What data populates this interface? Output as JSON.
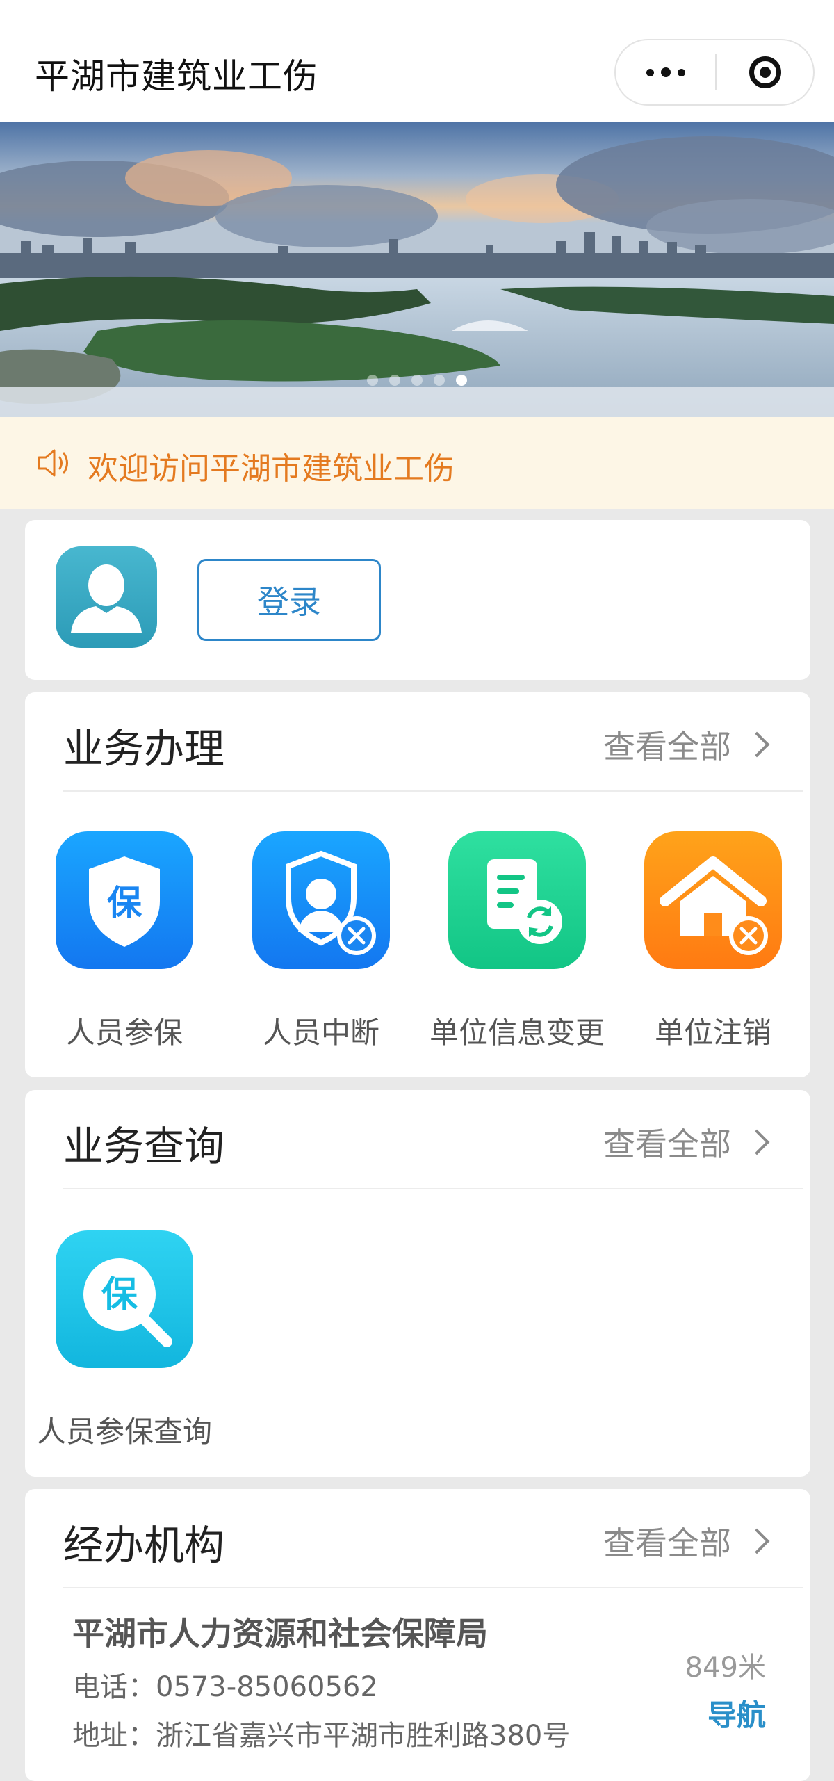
{
  "navbar": {
    "title": "平湖市建筑业工伤",
    "more_icon": "more-dots-icon",
    "close_icon": "target-close-icon"
  },
  "banner": {
    "slide_count": 5,
    "active_index": 4
  },
  "notice": {
    "icon": "speaker-icon",
    "text": "欢迎访问平湖市建筑业工伤",
    "color": "#e47a20"
  },
  "login": {
    "avatar_icon": "user-avatar-icon",
    "button_label": "登录",
    "accent": "#2d86c9"
  },
  "business": {
    "title": "业务办理",
    "view_all": "查看全部",
    "items": [
      {
        "label": "人员参保",
        "icon": "shield-bao-icon",
        "color": "#1e90f6"
      },
      {
        "label": "人员中断",
        "icon": "person-shield-cancel-icon",
        "color": "#1e8ef4"
      },
      {
        "label": "单位信息变更",
        "icon": "document-refresh-icon",
        "color": "#1ed391"
      },
      {
        "label": "单位注销",
        "icon": "house-cancel-icon",
        "color": "#ff8c1a"
      }
    ]
  },
  "query": {
    "title": "业务查询",
    "view_all": "查看全部",
    "items": [
      {
        "label": "人员参保查询",
        "icon": "search-bao-icon",
        "color": "#1cc3e8"
      }
    ]
  },
  "agency": {
    "title": "经办机构",
    "view_all": "查看全部",
    "items": [
      {
        "name": "平湖市人力资源和社会保障局",
        "phone": "电话：0573-85060562",
        "address": "地址：浙江省嘉兴市平湖市胜利路380号",
        "distance": "849米",
        "nav_label": "导航"
      }
    ]
  }
}
